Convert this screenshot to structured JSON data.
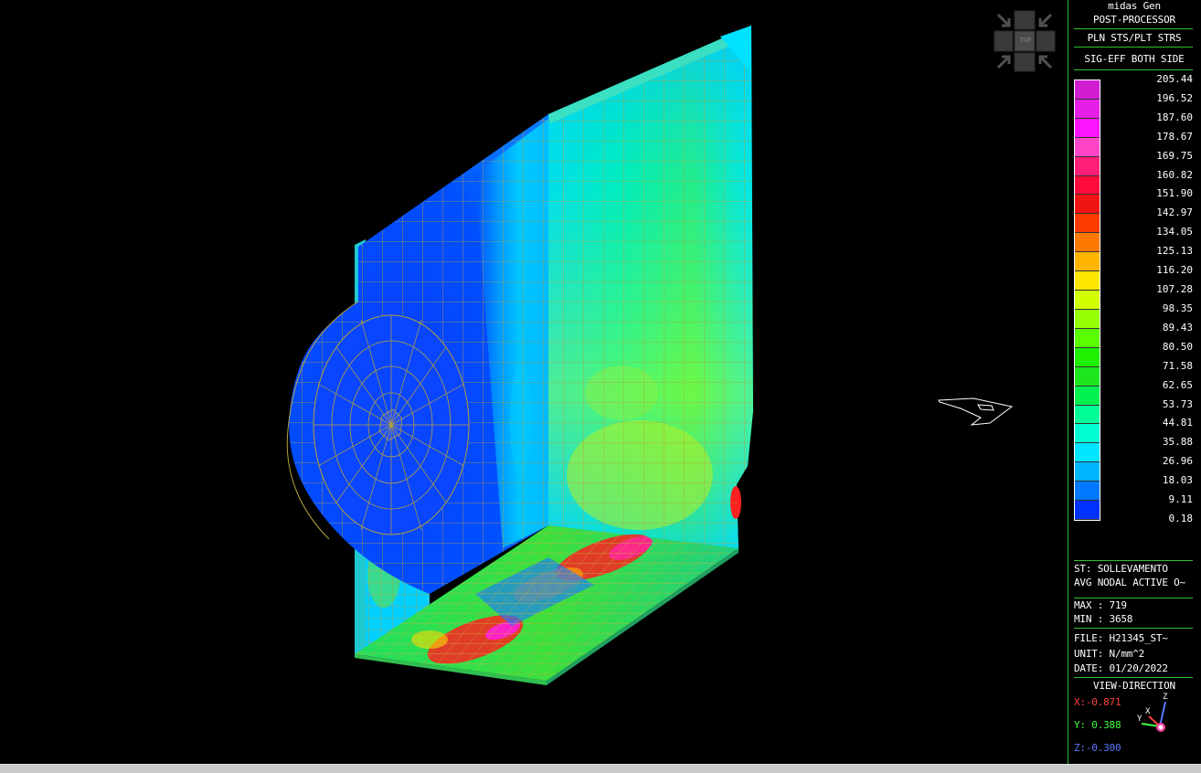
{
  "panel": {
    "app_title": "midas Gen",
    "mode": "POST-PROCESSOR",
    "result_type": "PLN STS/PLT STRS",
    "component": "SIG-EFF BOTH SIDE",
    "legend_values": [
      "205.44",
      "196.52",
      "187.60",
      "178.67",
      "169.75",
      "160.82",
      "151.90",
      "142.97",
      "134.05",
      "125.13",
      "116.20",
      "107.28",
      "98.35",
      "89.43",
      "80.50",
      "71.58",
      "62.65",
      "53.73",
      "44.81",
      "35.88",
      "26.96",
      "18.03",
      "9.11",
      "0.18"
    ],
    "legend_colors": [
      "#d21ed2",
      "#e61ee6",
      "#ff14ff",
      "#ff46c8",
      "#ff1e78",
      "#ff0a3c",
      "#f01414",
      "#ff3c00",
      "#ff7800",
      "#ffb400",
      "#ffe600",
      "#d2ff00",
      "#96ff00",
      "#5aff00",
      "#1ef000",
      "#1ee61e",
      "#00f050",
      "#00ff96",
      "#00ffd2",
      "#00e6ff",
      "#00b4ff",
      "#0078ff",
      "#0032ff"
    ],
    "step": "ST: SOLLEVAMENTO",
    "avg_mode": "AVG NODAL ACTIVE O~",
    "max": "MAX : 719",
    "min": "MIN : 3658",
    "file": "FILE: H21345_ST~",
    "unit": "UNIT: N/mm^2",
    "date": "DATE: 01/20/2022",
    "view_direction_title": "VIEW-DIRECTION",
    "vx": "X:-0.871",
    "vy": "Y: 0.388",
    "vz": "Z:-0.300"
  },
  "viewcube": {
    "label": "TOP"
  },
  "axes": {
    "x": "X",
    "y": "Y",
    "z": "Z"
  },
  "colors": {
    "panel_border": "#2cc02c",
    "vx": "#ff4040",
    "vy": "#3cff3c",
    "vz": "#5a78ff",
    "mesh": "#b4a03c"
  }
}
